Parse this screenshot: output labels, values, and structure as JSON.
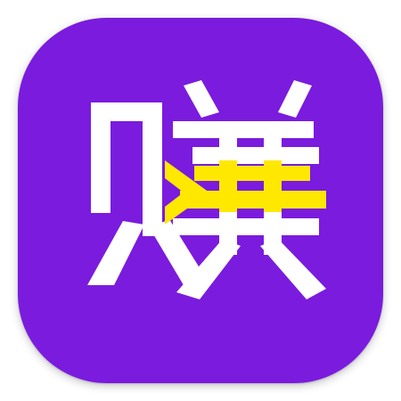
{
  "icon": {
    "name": "app-icon",
    "glyph": "赚",
    "colors": {
      "background": "#7A1BDE",
      "glyph": "#FFFFFF",
      "accent": "#FFE800"
    }
  }
}
